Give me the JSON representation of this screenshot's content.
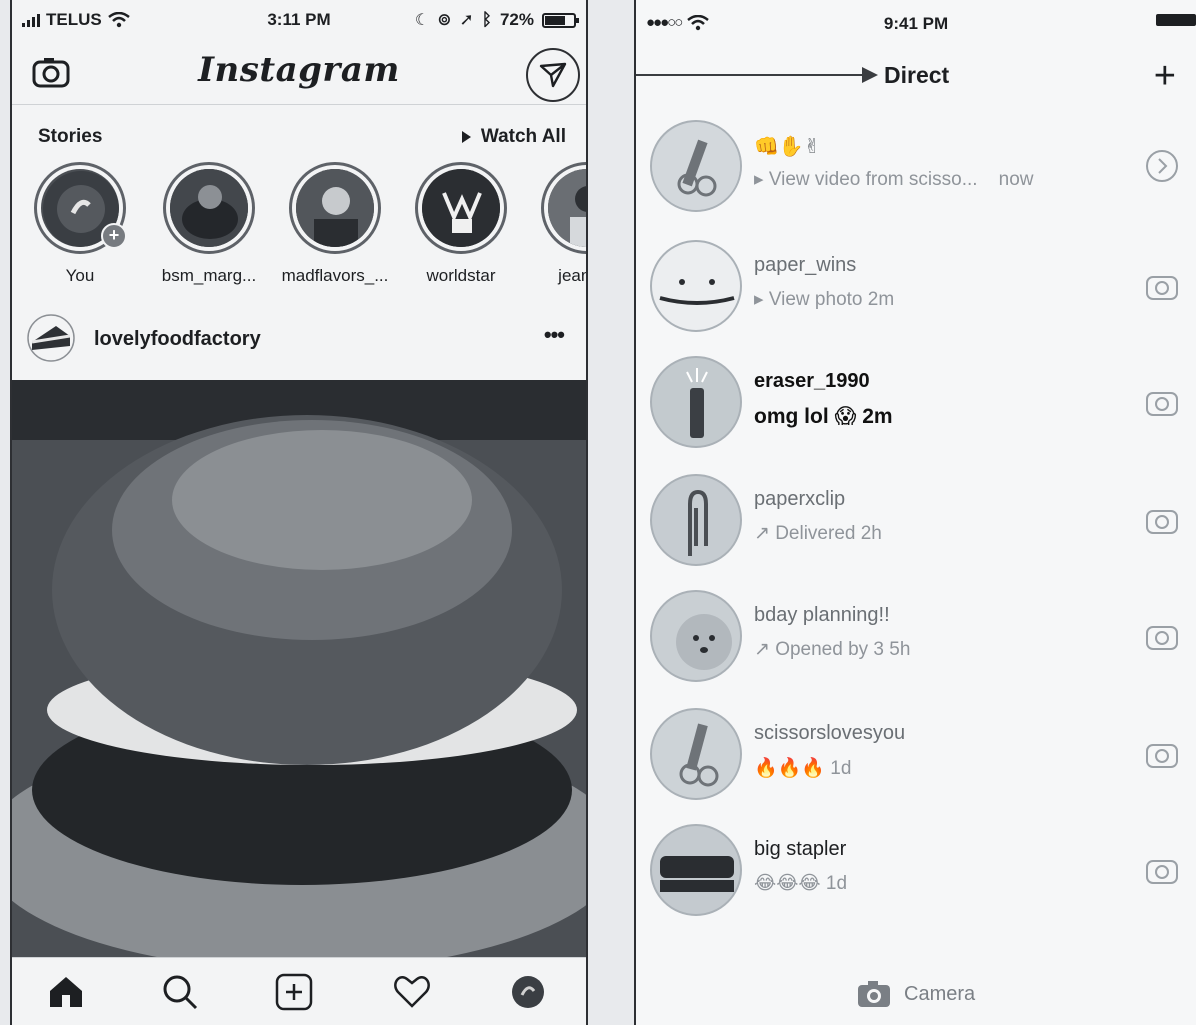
{
  "feed": {
    "status": {
      "carrier": "TELUS",
      "time": "3:11 PM",
      "battery": "72%",
      "battery_level": 0.72
    },
    "header": {
      "logo": "Instagram"
    },
    "stories": {
      "title": "Stories",
      "watch_all": "Watch All",
      "items": [
        {
          "label": "You"
        },
        {
          "label": "bsm_marg..."
        },
        {
          "label": "madflavors_..."
        },
        {
          "label": "worldstar"
        },
        {
          "label": "jeanfrar"
        }
      ]
    },
    "post": {
      "username": "lovelyfoodfactory",
      "more": "•••"
    }
  },
  "direct": {
    "status": {
      "time": "9:41 PM"
    },
    "header": {
      "title": "Direct",
      "add": "+"
    },
    "threads": [
      {
        "name": "👊✋✌",
        "sub": "▸ View video from scisso...",
        "time": "now",
        "unread": false,
        "action": "chevron-right-icon"
      },
      {
        "name": "paper_wins",
        "sub": "▸ View photo 2m",
        "unread": false,
        "action": "camera-icon"
      },
      {
        "name": "eraser_1990",
        "sub": "omg lol 😱 2m",
        "unread": true,
        "action": "camera-icon"
      },
      {
        "name": "paperxclip",
        "sub": "↗ Delivered 2h",
        "unread": false,
        "action": "camera-icon"
      },
      {
        "name": "bday planning!!",
        "sub": "↗ Opened by 3 5h",
        "unread": false,
        "action": "camera-icon"
      },
      {
        "name": "scissorslovesyou",
        "sub": "🔥🔥🔥 1d",
        "unread": false,
        "action": "camera-icon"
      },
      {
        "name": "big stapler",
        "sub": "😂😂😂 1d",
        "unread": false,
        "action": "camera-icon"
      }
    ],
    "camera_label": "Camera"
  }
}
